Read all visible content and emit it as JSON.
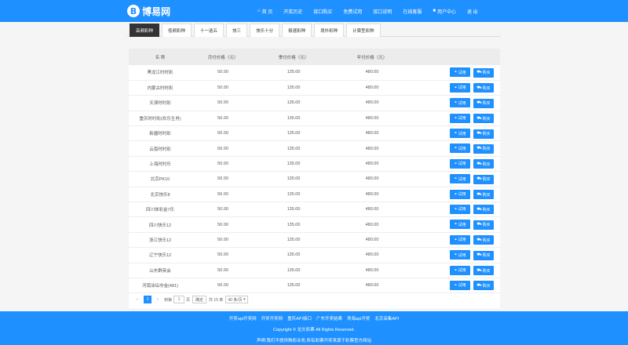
{
  "header": {
    "logo_mark": "B",
    "logo_text": "博易网",
    "nav": [
      {
        "icon": "home-icon",
        "glyph": "⌂",
        "label": "首 页"
      },
      {
        "icon": "",
        "glyph": "",
        "label": "开奖历史"
      },
      {
        "icon": "",
        "glyph": "",
        "label": "接口购买"
      },
      {
        "icon": "",
        "glyph": "",
        "label": "免费试用"
      },
      {
        "icon": "",
        "glyph": "",
        "label": "接口说明"
      },
      {
        "icon": "",
        "glyph": "",
        "label": "在线客服"
      },
      {
        "icon": "user-icon",
        "glyph": "■",
        "label": "用户中心"
      },
      {
        "icon": "",
        "glyph": "",
        "label": "退 出"
      }
    ]
  },
  "tabs": [
    "高频彩种",
    "低频彩种",
    "十一选五",
    "快三",
    "快乐十分",
    "极速彩种",
    "境外彩种",
    "计算型彩种"
  ],
  "active_tab": 0,
  "table": {
    "headers": [
      "名 称",
      "月付价格（元）",
      "季付价格（元）",
      "年付价格（元）"
    ],
    "trial_label": "试用",
    "buy_label": "购买",
    "rows": [
      {
        "name": "黑龙江时时彩",
        "month": "50.00",
        "quarter": "135.00",
        "year": "480.00"
      },
      {
        "name": "内蒙古时时彩",
        "month": "50.00",
        "quarter": "135.00",
        "year": "480.00"
      },
      {
        "name": "天津时时彩",
        "month": "50.00",
        "quarter": "135.00",
        "year": "480.00"
      },
      {
        "name": "重庆时时彩(欢乐生肖)",
        "month": "50.00",
        "quarter": "135.00",
        "year": "480.00"
      },
      {
        "name": "新疆时时彩",
        "month": "50.00",
        "quarter": "135.00",
        "year": "480.00"
      },
      {
        "name": "云南时时彩",
        "month": "50.00",
        "quarter": "135.00",
        "year": "480.00"
      },
      {
        "name": "上海时时乐",
        "month": "50.00",
        "quarter": "135.00",
        "year": "480.00"
      },
      {
        "name": "北京PK10",
        "month": "50.00",
        "quarter": "135.00",
        "year": "480.00"
      },
      {
        "name": "北京快乐8",
        "month": "50.00",
        "quarter": "135.00",
        "year": "480.00"
      },
      {
        "name": "四川体彩金7乐",
        "month": "50.00",
        "quarter": "135.00",
        "year": "480.00"
      },
      {
        "name": "四川快乐12",
        "month": "50.00",
        "quarter": "135.00",
        "year": "480.00"
      },
      {
        "name": "浙江快乐12",
        "month": "50.00",
        "quarter": "135.00",
        "year": "480.00"
      },
      {
        "name": "辽宁快乐12",
        "month": "50.00",
        "quarter": "135.00",
        "year": "480.00"
      },
      {
        "name": "山东群英会",
        "month": "50.00",
        "quarter": "135.00",
        "year": "480.00"
      },
      {
        "name": "河南泳坛夺金(481)",
        "month": "50.00",
        "quarter": "135.00",
        "year": "480.00"
      }
    ]
  },
  "pager": {
    "prev": "‹",
    "current": "1",
    "next": "›",
    "goto_label": "到第",
    "page_input": "1",
    "page_unit": "页",
    "confirm": "确定",
    "total": "共 15 条",
    "per_page": "40 条/页"
  },
  "footer": {
    "links": [
      "开奖api开奖网",
      "开奖开奖网",
      "重庆API接口",
      "广东开奖结果",
      "青海api开奖",
      "北京采集API"
    ],
    "copyright": "Copyright © 龙头彩票 All Rights Reserved.",
    "disclaimer": "声明:我们不提供购彩业务,所有彩票开奖来源于彩票官方网站"
  },
  "colors": {
    "primary": "#1e90ff",
    "active_tab": "#333333"
  }
}
